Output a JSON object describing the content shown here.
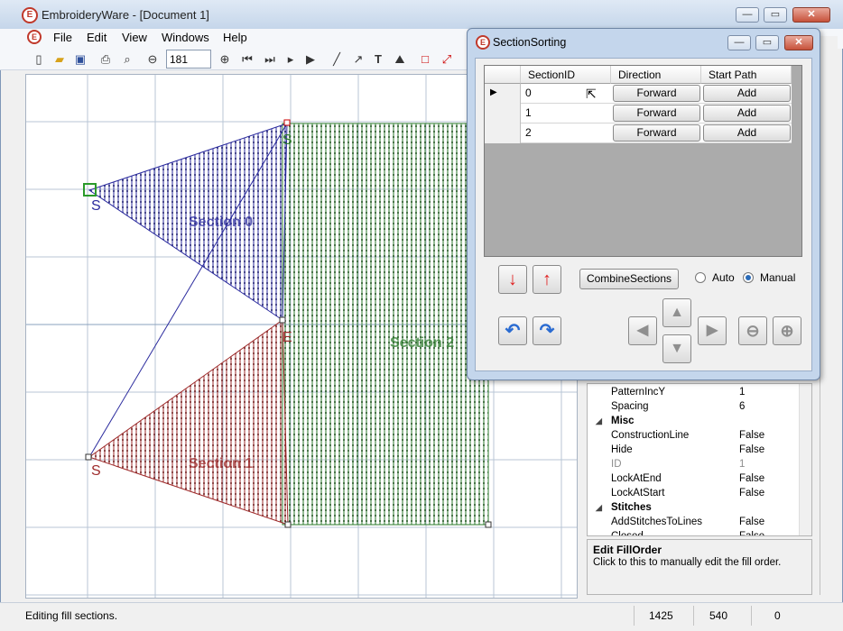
{
  "app": {
    "title": "EmbroideryWare - [Document 1]",
    "logo_glyph": "E"
  },
  "window_buttons": {
    "minimize": "—",
    "restore": "▭",
    "close": "✕"
  },
  "menu": [
    "File",
    "Edit",
    "View",
    "Windows",
    "Help"
  ],
  "toolbar": {
    "zoom_value": "181"
  },
  "canvas": {
    "section_labels": [
      "Section 0",
      "Section 1",
      "Section 2"
    ],
    "marker_start": "S",
    "marker_end": "E",
    "colors": {
      "section0": "#2b2b9e",
      "section1": "#9e2b2b",
      "section2": "#2b7a2b",
      "grid": "#b9c6d6"
    }
  },
  "dialog": {
    "title": "SectionSorting",
    "columns": [
      "SectionID",
      "Direction",
      "Start Path"
    ],
    "rows": [
      {
        "id": "0",
        "direction": "Forward",
        "start": "Add"
      },
      {
        "id": "1",
        "direction": "Forward",
        "start": "Add"
      },
      {
        "id": "2",
        "direction": "Forward",
        "start": "Add"
      }
    ],
    "row_indicator": "▶",
    "combine_label": "CombineSections",
    "mode_auto": "Auto",
    "mode_manual": "Manual",
    "selected_mode": "Manual"
  },
  "properties": {
    "rows": [
      {
        "kind": "prop",
        "name": "PatternIncY",
        "value": "1"
      },
      {
        "kind": "prop",
        "name": "Spacing",
        "value": "6"
      },
      {
        "kind": "cat",
        "name": "Misc"
      },
      {
        "kind": "prop",
        "name": "ConstructionLine",
        "value": "False"
      },
      {
        "kind": "prop",
        "name": "Hide",
        "value": "False"
      },
      {
        "kind": "prop",
        "name": "ID",
        "value": "1",
        "disabled": true
      },
      {
        "kind": "prop",
        "name": "LockAtEnd",
        "value": "False"
      },
      {
        "kind": "prop",
        "name": "LockAtStart",
        "value": "False"
      },
      {
        "kind": "cat",
        "name": "Stitches"
      },
      {
        "kind": "prop",
        "name": "AddStitchesToLines",
        "value": "False"
      },
      {
        "kind": "prop",
        "name": "Closed",
        "value": "False"
      }
    ],
    "help_title": "Edit FillOrder",
    "help_text": "Click to this to manually edit the fill order."
  },
  "status": {
    "message": "Editing fill sections.",
    "x": "1425",
    "y": "540",
    "z": "0"
  }
}
